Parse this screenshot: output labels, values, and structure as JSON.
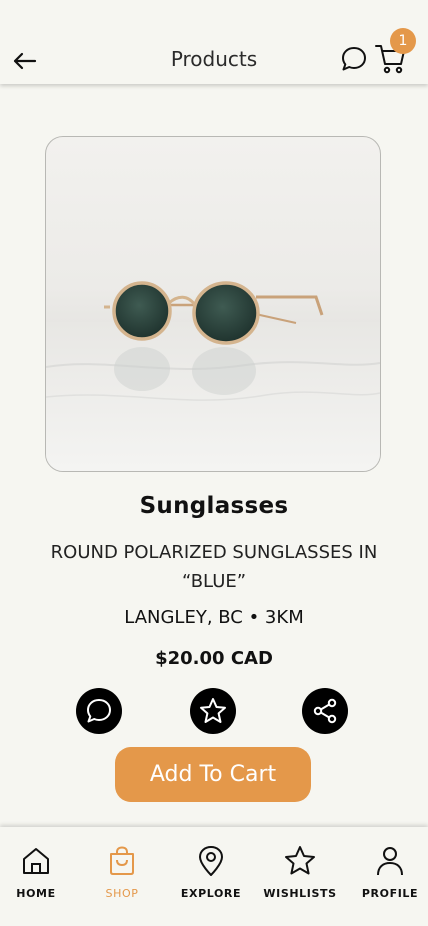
{
  "header": {
    "title": "Products",
    "cart_count": "1"
  },
  "product": {
    "name": "Sunglasses",
    "description": "ROUND POLARIZED SUNGLASSES IN “BLUE”",
    "location": "LANGLEY, BC • 3KM",
    "price": "$20.00 CAD",
    "add_to_cart_label": "Add To Cart"
  },
  "colors": {
    "accent": "#e4984a",
    "background": "#f6f6f1"
  },
  "icons": {
    "back": "arrow-left-icon",
    "chat": "chat-bubble-icon",
    "cart": "cart-icon",
    "favorite": "star-icon",
    "share": "share-icon"
  },
  "nav": {
    "items": [
      {
        "label": "HOME",
        "icon": "home-icon",
        "active": false
      },
      {
        "label": "SHOP",
        "icon": "shopping-bag-icon",
        "active": true
      },
      {
        "label": "EXPLORE",
        "icon": "map-pin-icon",
        "active": false
      },
      {
        "label": "WISHLISTS",
        "icon": "star-icon",
        "active": false
      },
      {
        "label": "PROFILE",
        "icon": "user-icon",
        "active": false
      }
    ]
  }
}
